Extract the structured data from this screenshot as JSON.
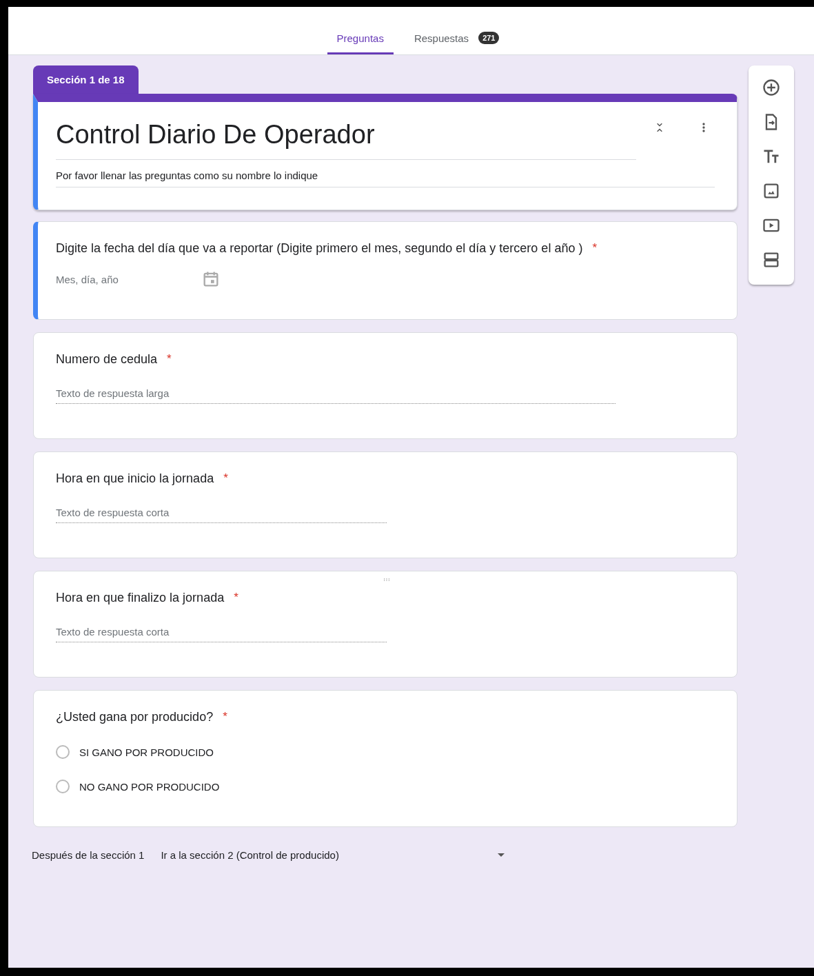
{
  "tabs": [
    {
      "label": "Preguntas",
      "selected": true
    },
    {
      "label": "Respuestas",
      "selected": false,
      "badge": "271"
    }
  ],
  "section": {
    "label": "Sección 1 de 18",
    "title": "Control Diario De Operador",
    "description": "Por favor llenar las preguntas como su nombre lo indique"
  },
  "questions": [
    {
      "kind": "date",
      "title": "Digite la fecha del día que va a reportar (Digite primero el mes, segundo el día y tercero el año )",
      "required_mark": "*",
      "focused": true,
      "hovered": false,
      "placeholder": "Mes, día, año"
    },
    {
      "kind": "paragraph",
      "title": "Numero de cedula",
      "required_mark": "*",
      "focused": false,
      "hovered": false,
      "placeholder": "Texto de respuesta larga"
    },
    {
      "kind": "short",
      "title": "Hora en que inicio la jornada",
      "required_mark": "*",
      "focused": false,
      "hovered": false,
      "placeholder": "Texto de respuesta corta"
    },
    {
      "kind": "short",
      "title": "Hora en que finalizo la jornada",
      "required_mark": "*",
      "focused": false,
      "hovered": true,
      "placeholder": "Texto de respuesta corta"
    },
    {
      "kind": "radio",
      "title": "¿Usted gana por producido?",
      "required_mark": "*",
      "focused": false,
      "hovered": false,
      "options": [
        {
          "label": "SI GANO POR PRODUCIDO",
          "selected": false
        },
        {
          "label": "NO GANO POR PRODUCIDO",
          "selected": false
        }
      ]
    }
  ],
  "after_section": {
    "label": "Después de la sección 1",
    "value": "Ir a la sección 2 (Control de producido)"
  }
}
